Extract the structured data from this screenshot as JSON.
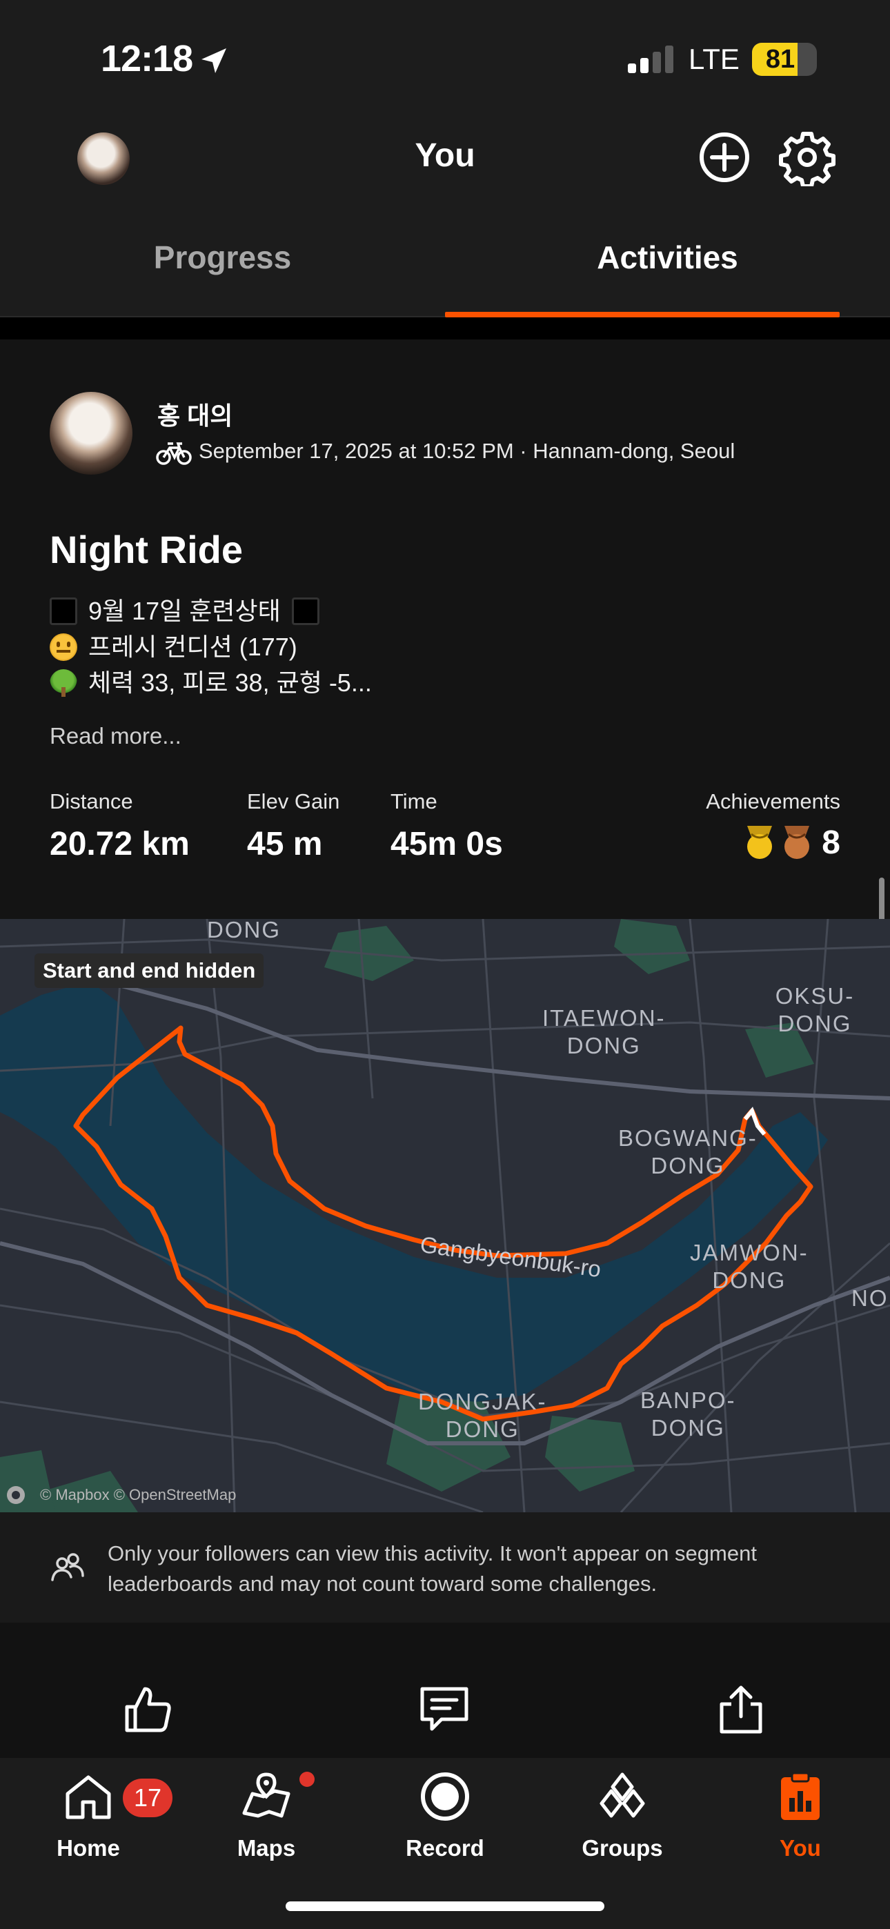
{
  "status_bar": {
    "time": "12:18",
    "network": "LTE",
    "battery_percent": 81
  },
  "header": {
    "title": "You",
    "tabs": [
      {
        "label": "Progress",
        "active": false
      },
      {
        "label": "Activities",
        "active": true
      }
    ]
  },
  "activity": {
    "athlete_name": "홍 대의",
    "sport_icon": "bike-icon",
    "meta": "September 17, 2025 at 10:52 PM · Hannam-dong, Seoul",
    "title": "Night Ride",
    "description": [
      {
        "emoji": "black-square-icon",
        "text": "9월 17일 훈련상태",
        "trailing_emoji": "black-square-icon"
      },
      {
        "emoji": "neutral-face-icon",
        "text": "프레시 컨디션 (177)"
      },
      {
        "emoji": "tree-icon",
        "text": "체력 33, 피로 38, 균형 -5..."
      }
    ],
    "read_more": "Read more...",
    "stats": [
      {
        "label": "Distance",
        "value": "20.72 km"
      },
      {
        "label": "Elev Gain",
        "value": "45 m"
      },
      {
        "label": "Time",
        "value": "45m 0s"
      }
    ],
    "achievements": {
      "label": "Achievements",
      "count": "8",
      "medals": [
        "gold-medal-icon",
        "bronze-medal-icon"
      ]
    }
  },
  "map": {
    "badge": "Start and end hidden",
    "labels": {
      "dong_top": "DONG",
      "itaewon": "ITAEWON-\nDONG",
      "oksu": "OKSU-DONG",
      "bogwang": "BOGWANG-\nDONG",
      "gangbyeon": "Gangbyeonbuk-ro",
      "jamwon": "JAMWON-\nDONG",
      "no": "NO",
      "dongjak": "DONGJAK-\nDONG",
      "banpo": "BANPO-\nDONG"
    },
    "attribution": "© Mapbox © OpenStreetMap",
    "route_color": "#fc5200",
    "river_color": "#153a4f"
  },
  "privacy_notice": "Only your followers can view this activity. It won't appear on segment leaderboards and may not count toward some challenges.",
  "actions": [
    "thumbs-up-icon",
    "comment-icon",
    "share-icon"
  ],
  "tabbar": {
    "items": [
      {
        "label": "Home",
        "icon": "home-icon",
        "badge": "17",
        "active": false
      },
      {
        "label": "Maps",
        "icon": "maps-icon",
        "dot": true,
        "active": false
      },
      {
        "label": "Record",
        "icon": "record-icon",
        "active": false
      },
      {
        "label": "Groups",
        "icon": "groups-icon",
        "active": false
      },
      {
        "label": "You",
        "icon": "you-icon",
        "active": true
      }
    ]
  },
  "colors": {
    "accent": "#fc5200",
    "badge_red": "#e0352b",
    "battery_yellow": "#f7d31a"
  }
}
